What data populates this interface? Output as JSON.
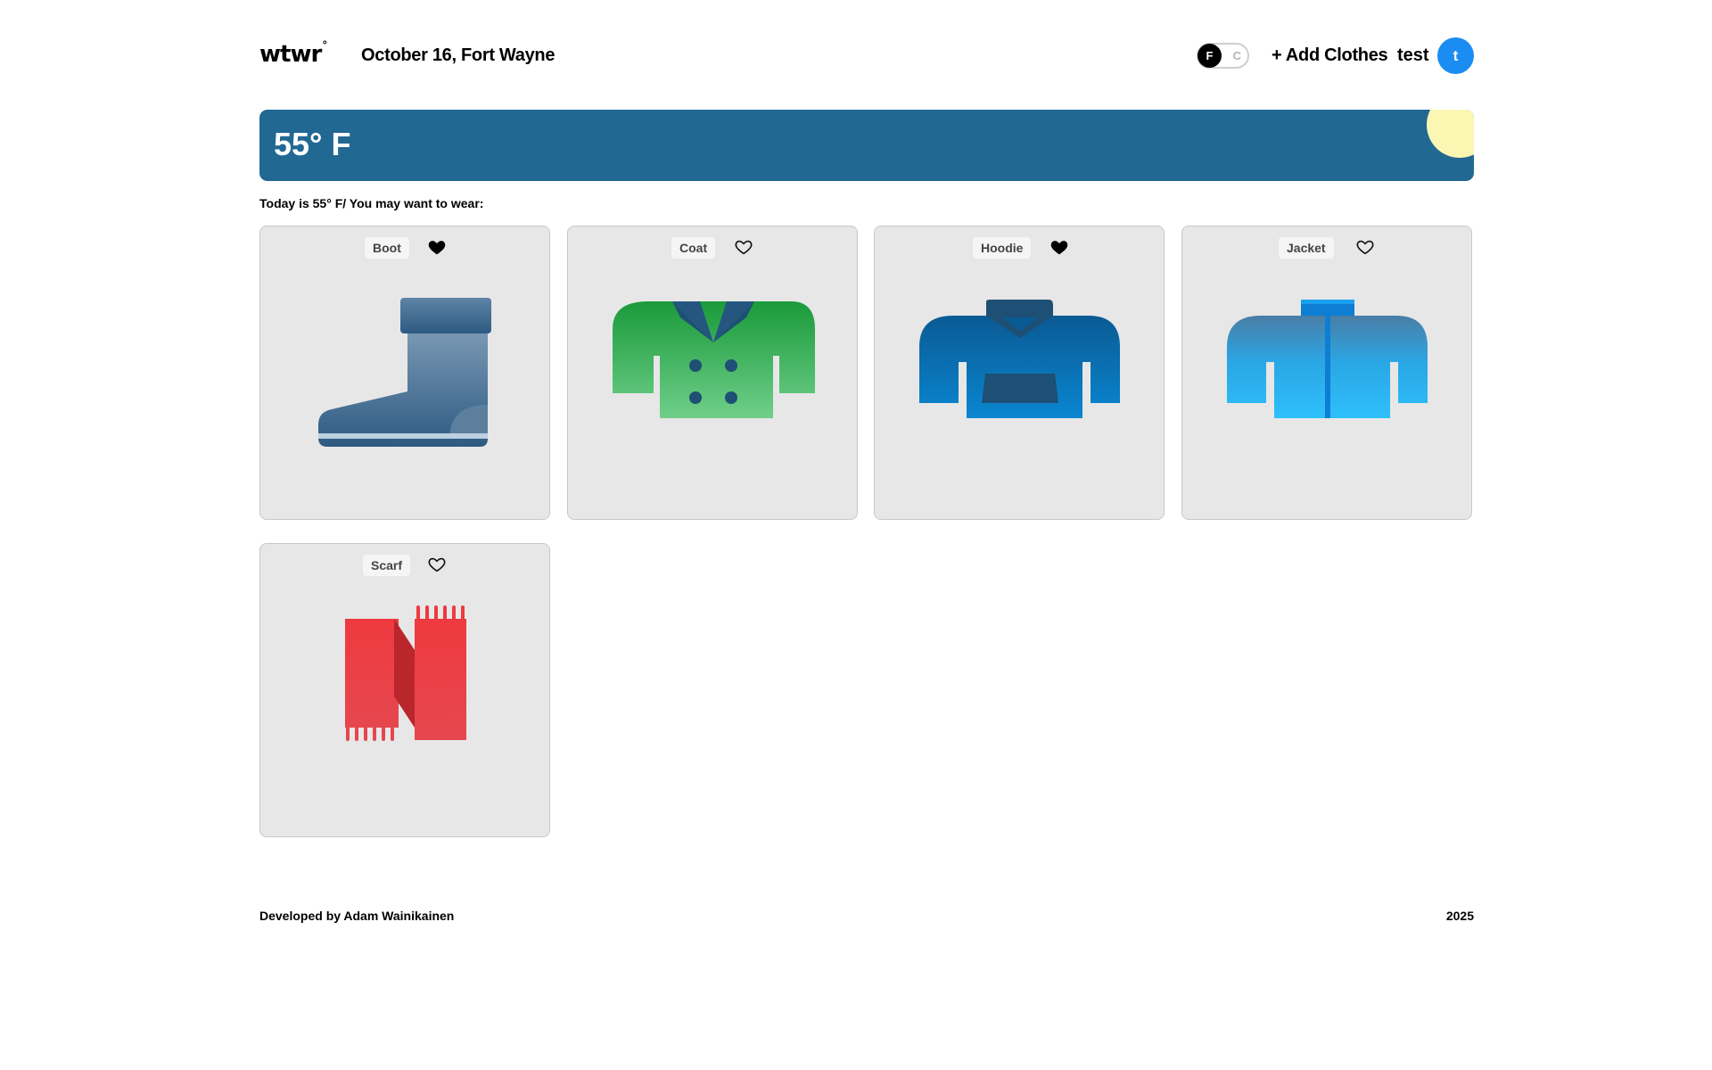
{
  "header": {
    "logo": "wtwr",
    "logo_mark": "°",
    "date_location": "October 16, Fort Wayne",
    "toggle": {
      "active": "F",
      "inactive": "C"
    },
    "add_clothes_label": "+ Add Clothes",
    "username": "test",
    "avatar_initial": "t"
  },
  "weather": {
    "temperature": "55° F",
    "banner_color": "#216893",
    "sun_color": "#fbf7b2"
  },
  "main": {
    "wear_text": "Today is 55° F/ You may want to wear:"
  },
  "items": [
    {
      "name": "Boot",
      "liked": true
    },
    {
      "name": "Coat",
      "liked": false
    },
    {
      "name": "Hoodie",
      "liked": true
    },
    {
      "name": "Jacket",
      "liked": false
    },
    {
      "name": "Scarf",
      "liked": false
    }
  ],
  "footer": {
    "developer": "Developed by Adam Wainikainen",
    "year": "2025"
  }
}
